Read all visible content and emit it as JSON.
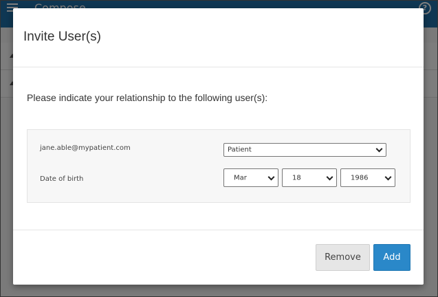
{
  "app": {
    "title": "Compose"
  },
  "dialog": {
    "title": "Invite User(s)",
    "intro": "Please indicate your relationship to the following user(s):",
    "user": {
      "email": "jane.able@mypatient.com",
      "relationship": "Patient",
      "dob_label": "Date of birth",
      "dob_month": "Mar",
      "dob_day": "18",
      "dob_year": "1986"
    },
    "buttons": {
      "remove": "Remove",
      "add": "Add"
    }
  },
  "colors": {
    "app_bar": "#1f6fa6",
    "primary_button": "#2a88c9",
    "secondary_button": "#e6e6e6"
  },
  "icons": {
    "menu": "menu-icon",
    "help": "help-icon",
    "select_chevron": "chevron-down-icon"
  }
}
